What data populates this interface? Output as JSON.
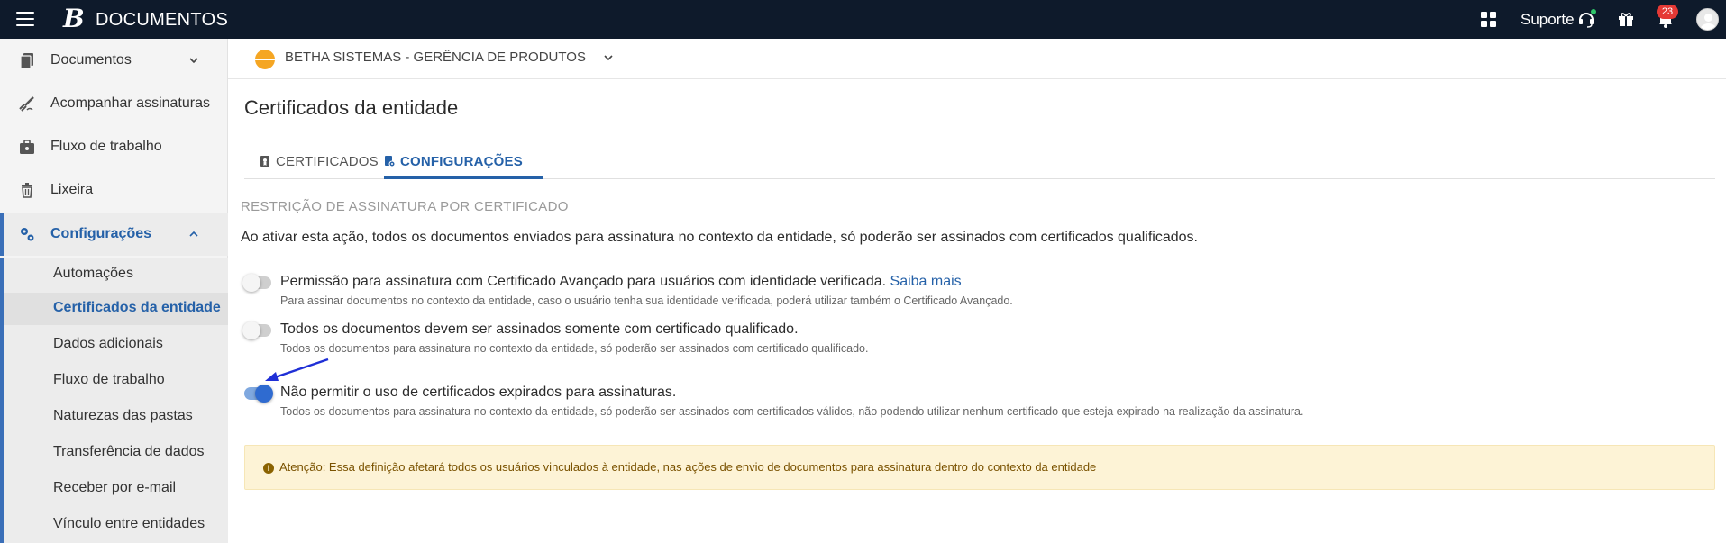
{
  "app": {
    "title": "DOCUMENTOS",
    "brand_letter": "B",
    "support_label": "Suporte",
    "notification_count": "23"
  },
  "sidebar": {
    "items": [
      {
        "label": "Documentos",
        "icon": "documents-icon"
      },
      {
        "label": "Acompanhar assinaturas",
        "icon": "signature-icon"
      },
      {
        "label": "Fluxo de trabalho",
        "icon": "briefcase-icon"
      },
      {
        "label": "Lixeira",
        "icon": "trash-icon"
      },
      {
        "label": "Configurações",
        "icon": "gears-icon"
      }
    ],
    "sub_items": [
      {
        "label": "Automações"
      },
      {
        "label": "Certificados da entidade"
      },
      {
        "label": "Dados adicionais"
      },
      {
        "label": "Fluxo de trabalho"
      },
      {
        "label": "Naturezas das pastas"
      },
      {
        "label": "Transferência de dados"
      },
      {
        "label": "Receber por e-mail"
      },
      {
        "label": "Vínculo entre entidades"
      }
    ]
  },
  "entity": {
    "name": "BETHA SISTEMAS - GERÊNCIA DE PRODUTOS"
  },
  "page": {
    "title": "Certificados da entidade",
    "tabs": [
      {
        "label": "CERTIFICADOS"
      },
      {
        "label": "CONFIGURAÇÕES"
      }
    ],
    "active_tab": "CONFIGURAÇÕES"
  },
  "section": {
    "title": "RESTRIÇÃO DE ASSINATURA POR CERTIFICADO",
    "description": "Ao ativar esta ação, todos os documentos enviados para assinatura no contexto da entidade, só poderão ser assinados com certificados qualificados."
  },
  "options": [
    {
      "label": "Permissão para assinatura com Certificado Avançado para usuários com identidade verificada.",
      "link": "Saiba mais",
      "help": "Para assinar documentos no contexto da entidade, caso o usuário tenha sua identidade verificada, poderá utilizar também o Certificado Avançado.",
      "enabled": false
    },
    {
      "label": "Todos os documentos devem ser assinados somente com certificado qualificado.",
      "help": "Todos os documentos para assinatura no contexto da entidade, só poderão ser assinados com certificado qualificado.",
      "enabled": false
    },
    {
      "label": "Não permitir o uso de certificados expirados para assinaturas.",
      "help": "Todos os documentos para assinatura no contexto da entidade, só poderão ser assinados com certificados válidos, não podendo utilizar nenhum certificado que esteja expirado na realização da assinatura.",
      "enabled": true
    }
  ],
  "alert": {
    "text": "Atenção: Essa definição afetará todos os usuários vinculados à entidade, nas ações de envio de documentos para assinatura dentro do contexto da entidade",
    "icon": "info-icon"
  },
  "colors": {
    "topbar": "#0e1a2b",
    "accent": "#2561a8",
    "alert_bg": "#fdf3d6",
    "annotation_arrow": "#1f2fd6"
  }
}
